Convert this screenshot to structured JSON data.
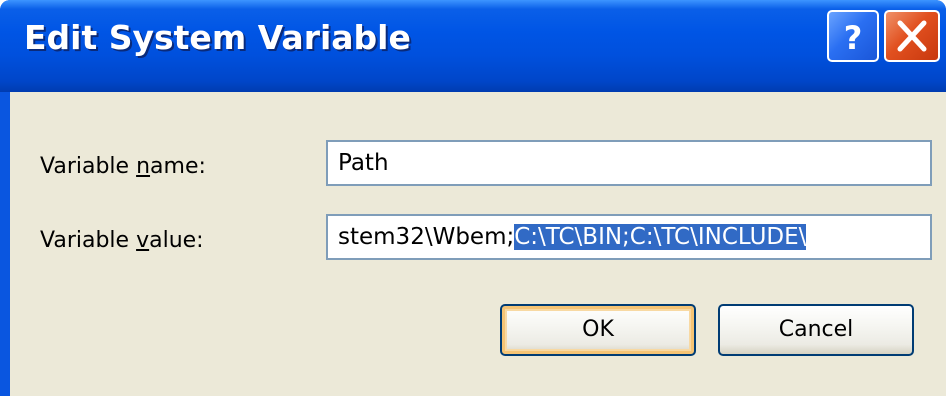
{
  "window": {
    "title": "Edit System Variable"
  },
  "titlebar_buttons": {
    "help_icon": "question-mark-icon",
    "close_icon": "close-x-icon"
  },
  "form": {
    "name_label_pre": "Variable ",
    "name_label_u": "n",
    "name_label_post": "ame:",
    "name_value": "Path",
    "value_label_pre": "Variable ",
    "value_label_u": "v",
    "value_label_post": "alue:",
    "value_visible_unselected": "stem32\\Wbem;",
    "value_visible_selected": "C:\\TC\\BIN;C:\\TC\\INCLUDE\\"
  },
  "buttons": {
    "ok_label": "OK",
    "cancel_label": "Cancel"
  },
  "colors": {
    "titlebar": "#0055e5",
    "client_bg": "#ece9d8",
    "selection": "#316ac5",
    "close_button": "#e1501f"
  }
}
